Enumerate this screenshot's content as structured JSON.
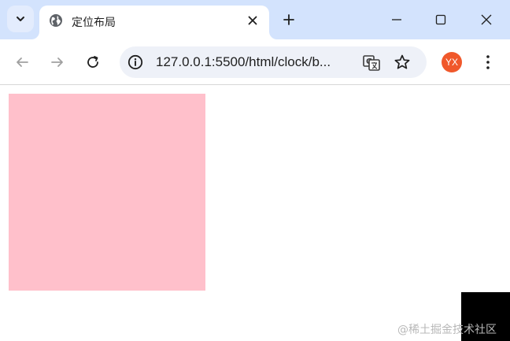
{
  "tab": {
    "title": "定位布局"
  },
  "address_bar": {
    "url": "127.0.0.1:5500/html/clock/b..."
  },
  "profile": {
    "initials": "YX",
    "color": "#f0582b"
  },
  "page": {
    "box1_color": "#ffc0cb",
    "box2_color": "#000000"
  },
  "watermark": {
    "text": "@稀土掘金技术社区"
  },
  "icons": [
    "tab-search-icon",
    "globe-icon",
    "close-icon",
    "plus-icon",
    "minimize-icon",
    "maximize-icon",
    "window-close-icon",
    "back-arrow-icon",
    "forward-arrow-icon",
    "reload-icon",
    "info-icon",
    "translate-icon",
    "star-icon",
    "more-vert-icon"
  ]
}
